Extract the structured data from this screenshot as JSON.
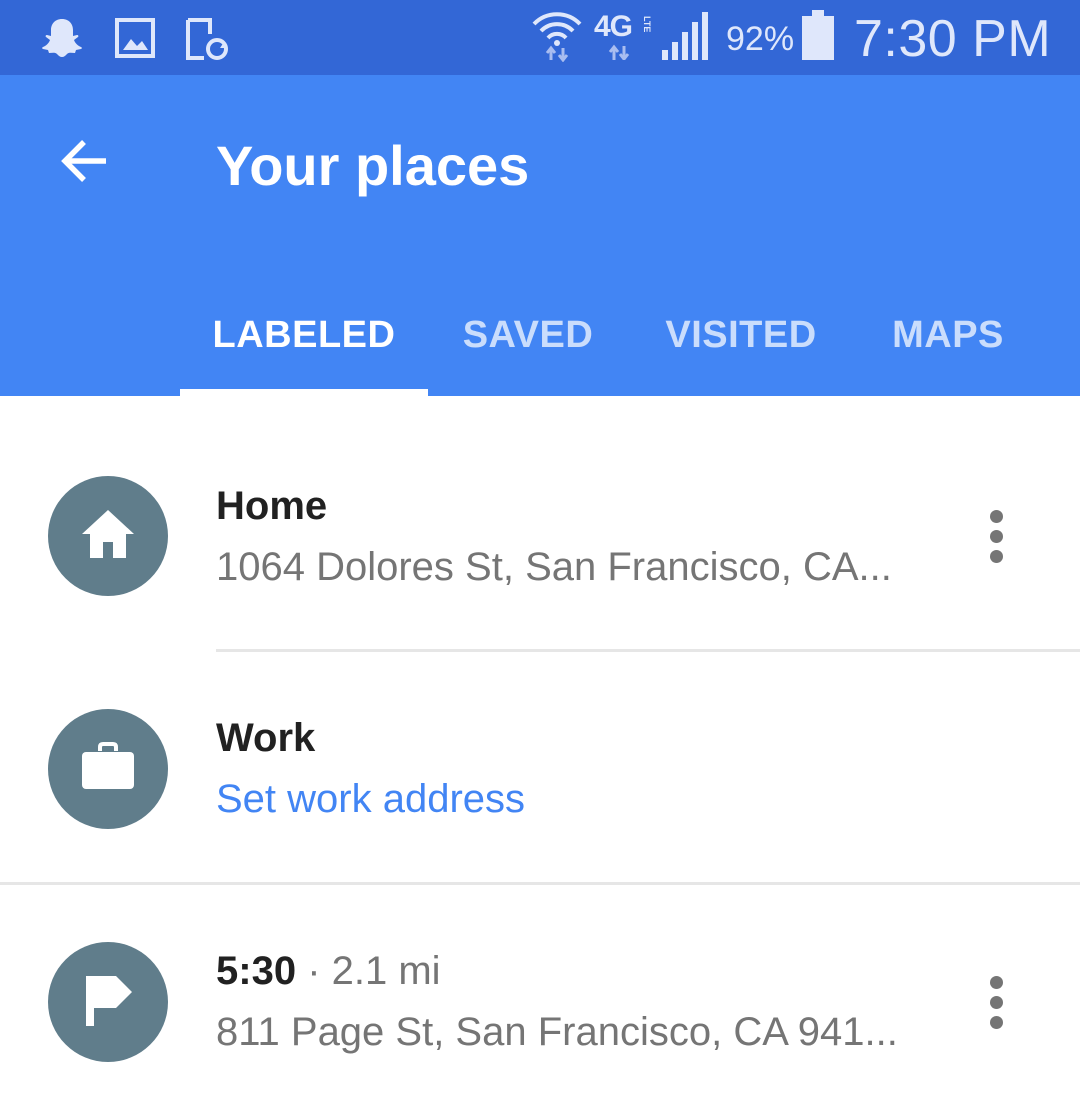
{
  "status_bar": {
    "battery_percent": "92%",
    "time": "7:30 PM",
    "network": "4G",
    "icons": [
      "snapchat-icon",
      "gallery-icon",
      "screen-rotate-icon",
      "wifi-icon",
      "lte-icon",
      "signal-icon",
      "battery-icon"
    ]
  },
  "app_bar": {
    "title": "Your places",
    "back_icon": "arrow-back-icon"
  },
  "tabs": [
    {
      "label": "LABELED",
      "active": true
    },
    {
      "label": "SAVED",
      "active": false
    },
    {
      "label": "VISITED",
      "active": false
    },
    {
      "label": "MAPS",
      "active": false
    }
  ],
  "places": [
    {
      "icon": "home-icon",
      "title": "Home",
      "subtitle": "1064 Dolores St, San Francisco, CA..."
    },
    {
      "icon": "briefcase-icon",
      "title": "Work",
      "link": "Set work address"
    },
    {
      "icon": "flag-icon",
      "title": "5:30",
      "meta": "· 2.1 mi",
      "subtitle": "811 Page St, San Francisco, CA 941..."
    }
  ],
  "colors": {
    "status_bar": "#3367d6",
    "app_bar": "#4285f4",
    "avatar": "#607d8b",
    "link": "#4285f4"
  }
}
